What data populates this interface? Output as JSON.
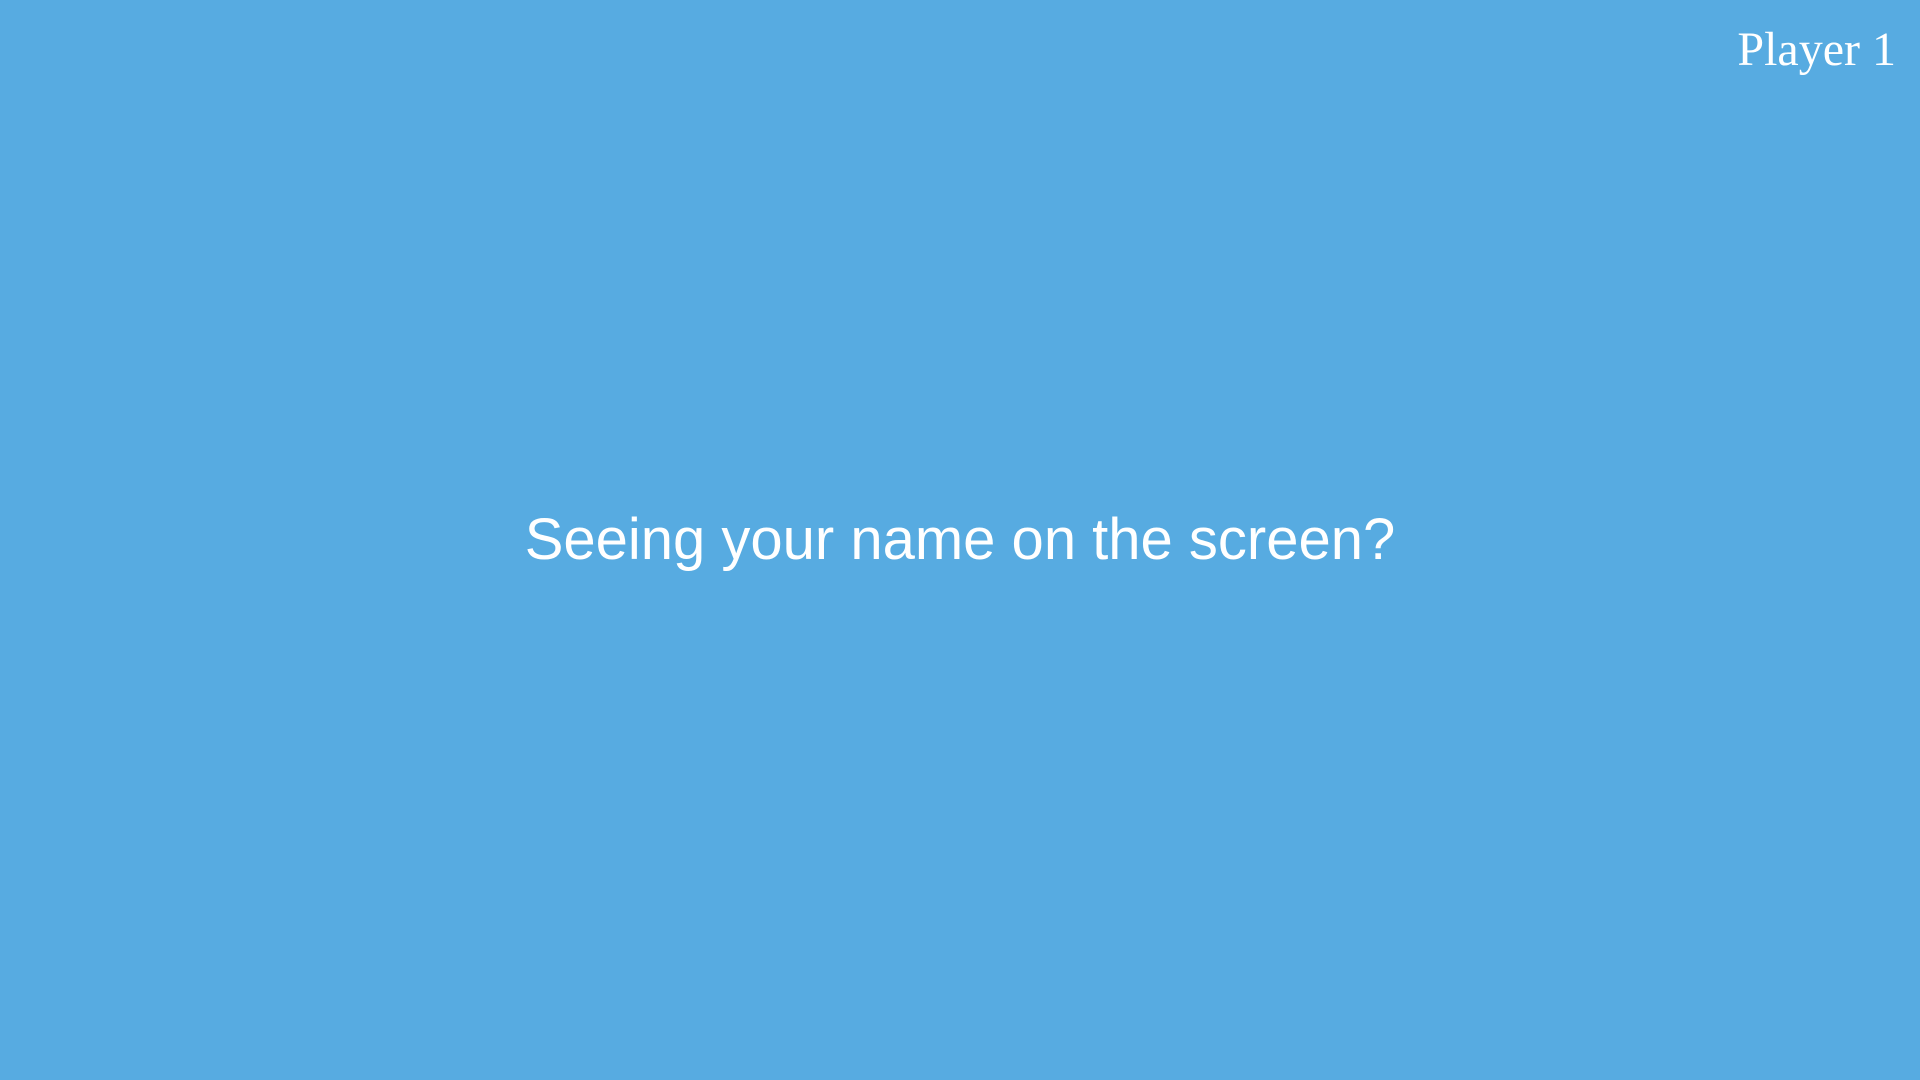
{
  "colors": {
    "background": "#57ABE1",
    "text": "#FFFFFF"
  },
  "header": {
    "player_label": "Player 1"
  },
  "main": {
    "prompt": "Seeing your name on the screen?"
  }
}
